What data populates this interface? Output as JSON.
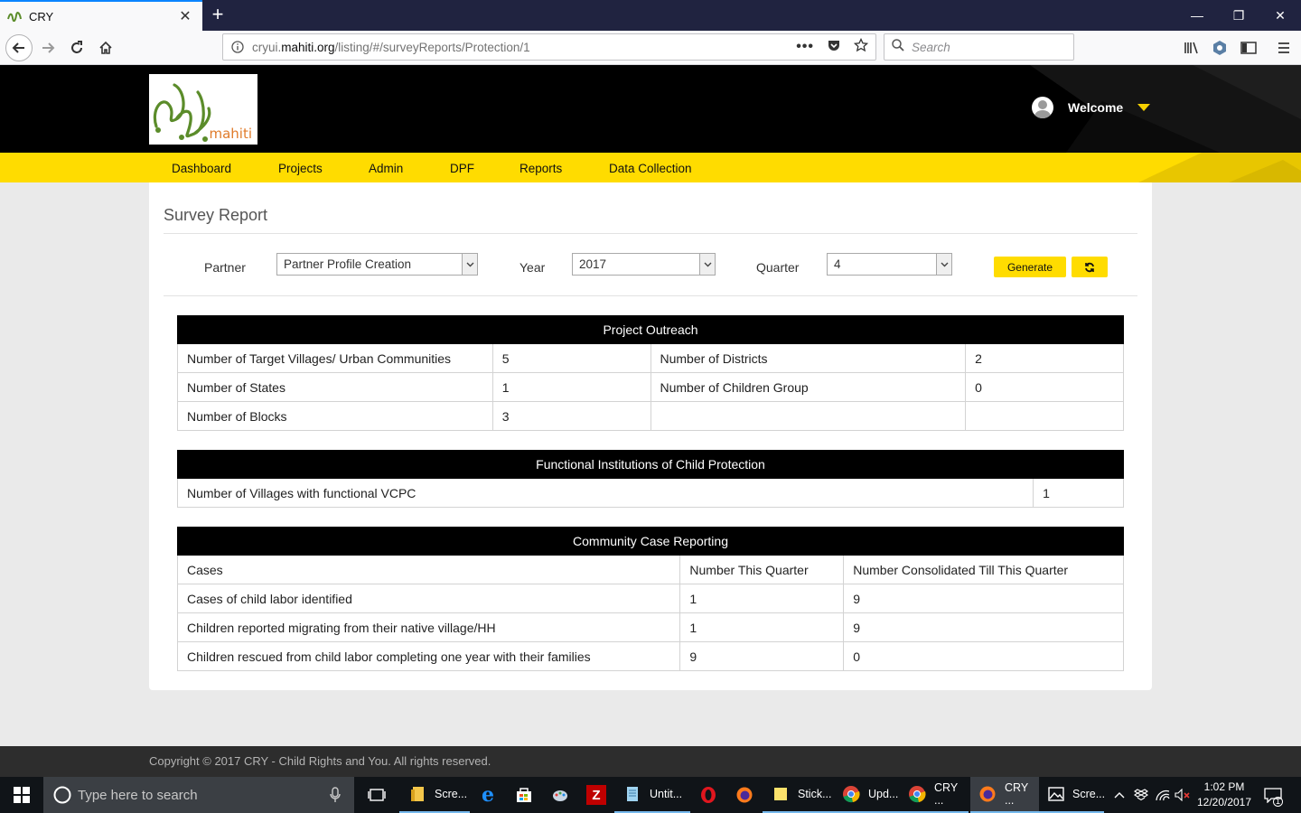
{
  "browser": {
    "tab_title": "CRY",
    "url_scheme_path_prefix": "cryui.",
    "url_host": "mahiti.org",
    "url_path": "/listing/#/surveyReports/Protection/1",
    "search_placeholder": "Search",
    "window_controls": [
      "minimize",
      "restore",
      "close"
    ]
  },
  "header": {
    "logo_text": "mahiti",
    "welcome": "Welcome"
  },
  "menu": [
    "Dashboard",
    "Projects",
    "Admin",
    "DPF",
    "Reports",
    "Data Collection"
  ],
  "page": {
    "title": "Survey Report",
    "filters": {
      "partner_label": "Partner",
      "partner_value": "Partner Profile Creation",
      "year_label": "Year",
      "year_value": "2017",
      "quarter_label": "Quarter",
      "quarter_value": "4"
    },
    "generate_label": "Generate"
  },
  "outreach": {
    "title": "Project Outreach",
    "rows": [
      [
        "Number of Target Villages/ Urban Communities",
        "5",
        "Number of Districts",
        "2"
      ],
      [
        "Number of States",
        "1",
        "Number of Children Group",
        "0"
      ],
      [
        "Number of Blocks",
        "3",
        "",
        ""
      ]
    ]
  },
  "institutions": {
    "title": "Functional Institutions of Child Protection",
    "rows": [
      [
        "Number of Villages with functional VCPC",
        "1"
      ]
    ]
  },
  "cases": {
    "title": "Community Case Reporting",
    "headers": [
      "Cases",
      "Number This Quarter",
      "Number Consolidated Till This Quarter"
    ],
    "rows": [
      [
        "Cases of child labor identified",
        "1",
        "9"
      ],
      [
        "Children reported migrating from their native village/HH",
        "1",
        "9"
      ],
      [
        "Children rescued from child labor completing one year with their families",
        "9",
        "0"
      ]
    ]
  },
  "footer": {
    "copyright": "Copyright © 2017 CRY - Child Rights and You. All rights reserved."
  },
  "taskbar": {
    "search_placeholder": "Type here to search",
    "items": [
      {
        "label": "Scre...",
        "icon": "file-explorer-icon"
      },
      {
        "label": "",
        "icon": "edge-icon"
      },
      {
        "label": "",
        "icon": "store-icon"
      },
      {
        "label": "",
        "icon": "paint-icon"
      },
      {
        "label": "",
        "icon": "filezilla-icon"
      },
      {
        "label": "Untit...",
        "icon": "notepad-icon"
      },
      {
        "label": "",
        "icon": "opera-icon"
      },
      {
        "label": "",
        "icon": "firefox-icon"
      },
      {
        "label": "Stick...",
        "icon": "sticky-notes-icon"
      },
      {
        "label": "Upd...",
        "icon": "chrome-icon"
      },
      {
        "label": "CRY ...",
        "icon": "chrome-icon"
      },
      {
        "label": "CRY ...",
        "icon": "firefox-icon"
      },
      {
        "label": "Scre...",
        "icon": "photos-icon"
      }
    ],
    "time": "1:02 PM",
    "date": "12/20/2017",
    "notification_count": "1"
  }
}
